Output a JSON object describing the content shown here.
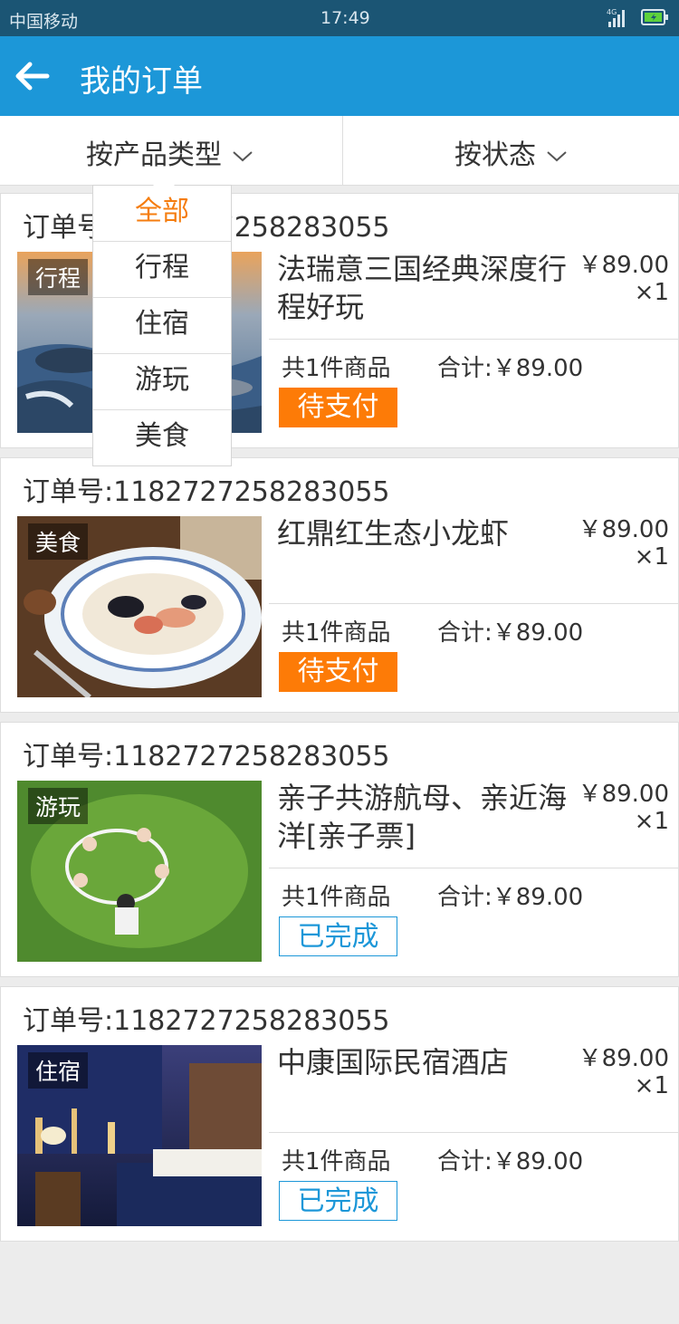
{
  "statusbar": {
    "carrier": "中国移动",
    "time": "17:49",
    "network": "4G"
  },
  "header": {
    "title": "我的订单"
  },
  "filters": {
    "by_type": "按产品类型",
    "by_status": "按状态"
  },
  "dropdown": {
    "items": [
      "全部",
      "行程",
      "住宿",
      "游玩",
      "美食"
    ],
    "active": "全部"
  },
  "orders": [
    {
      "order_no": "订单号:1182727258283055",
      "tag": "行程",
      "name": "法瑞意三国经典深度行程好玩",
      "price": "￥89.00",
      "qty": "×1",
      "count": "共1件商品",
      "total": "合计:￥89.00",
      "status": "待支付"
    },
    {
      "order_no": "订单号:1182727258283055",
      "tag": "美食",
      "name": "红鼎红生态小龙虾",
      "price": "￥89.00",
      "qty": "×1",
      "count": "共1件商品",
      "total": "合计:￥89.00",
      "status": "待支付"
    },
    {
      "order_no": "订单号:1182727258283055",
      "tag": "游玩",
      "name": "亲子共游航母、亲近海洋[亲子票]",
      "price": "￥89.00",
      "qty": "×1",
      "count": "共1件商品",
      "total": "合计:￥89.00",
      "status": "已完成"
    },
    {
      "order_no": "订单号:1182727258283055",
      "tag": "住宿",
      "name": "中康国际民宿酒店",
      "price": "￥89.00",
      "qty": "×1",
      "count": "共1件商品",
      "total": "合计:￥89.00",
      "status": "已完成"
    }
  ],
  "colors": {
    "statusbar": "#1b5574",
    "header": "#1c97d8",
    "pending": "#fd7b07",
    "done": "#1c97d8",
    "active_item": "#f57d0f"
  }
}
